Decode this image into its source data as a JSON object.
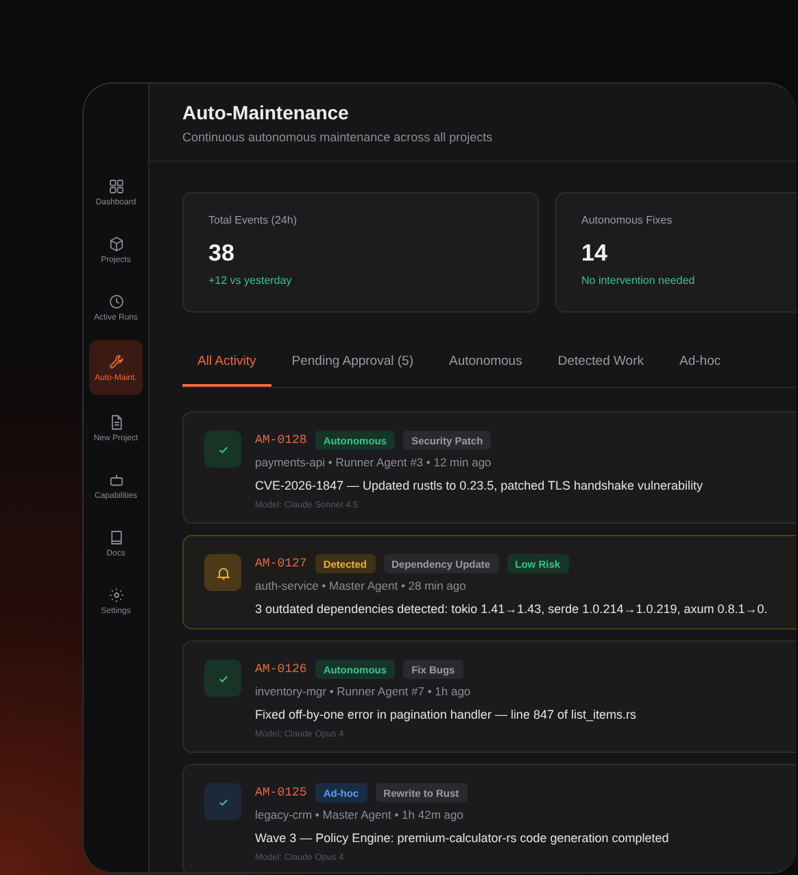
{
  "sidebar": {
    "items": [
      {
        "label": "Dashboard",
        "selected": false
      },
      {
        "label": "Projects",
        "selected": false
      },
      {
        "label": "Active Runs",
        "selected": false
      },
      {
        "label": "Auto-Maint.",
        "selected": true
      },
      {
        "label": "New Project",
        "selected": false
      },
      {
        "label": "Capabilities",
        "selected": false
      },
      {
        "label": "Docs",
        "selected": false
      },
      {
        "label": "Settings",
        "selected": false
      }
    ]
  },
  "header": {
    "title": "Auto-Maintenance",
    "subtitle": "Continuous autonomous maintenance across all projects"
  },
  "stats": [
    {
      "label": "Total Events (24h)",
      "value": "38",
      "note": "+12 vs yesterday"
    },
    {
      "label": "Autonomous Fixes",
      "value": "14",
      "note": "No intervention needed"
    }
  ],
  "tabs": [
    {
      "label": "All Activity",
      "selected": true
    },
    {
      "label": "Pending Approval (5)",
      "selected": false
    },
    {
      "label": "Autonomous",
      "selected": false
    },
    {
      "label": "Detected Work",
      "selected": false
    },
    {
      "label": "Ad-hoc",
      "selected": false
    }
  ],
  "events": [
    {
      "kind": "done",
      "id": "AM-0128",
      "badges": [
        {
          "label": "Autonomous",
          "kind": "mode"
        },
        {
          "label": "Security Patch",
          "kind": "category"
        }
      ],
      "meta": "payments-api • Runner Agent #3 • 12 min ago",
      "description": "CVE-2026-1847 — Updated rustls to 0.23.5, patched TLS handshake vulnerability",
      "model": "Model: Claude Sonnet 4.5"
    },
    {
      "kind": "alert",
      "id": "AM-0127",
      "badges": [
        {
          "label": "Detected",
          "kind": "pending"
        },
        {
          "label": "Dependency Update",
          "kind": "category"
        },
        {
          "label": "Low Risk",
          "kind": "risk"
        }
      ],
      "meta": "auth-service • Master Agent • 28 min ago",
      "description": "3 outdated dependencies detected: tokio 1.41→1.43, serde 1.0.214→1.0.219, axum 0.8.1→0."
    },
    {
      "kind": "done",
      "id": "AM-0126",
      "badges": [
        {
          "label": "Autonomous",
          "kind": "mode"
        },
        {
          "label": "Fix Bugs",
          "kind": "category"
        }
      ],
      "meta": "inventory-mgr • Runner Agent #7 • 1h ago",
      "description": "Fixed off-by-one error in pagination handler — line 847 of list_items.rs",
      "model": "Model: Claude Opus 4"
    },
    {
      "kind": "manual",
      "id": "AM-0125",
      "badges": [
        {
          "label": "Ad-hoc",
          "kind": "manual"
        },
        {
          "label": "Rewrite to Rust",
          "kind": "category"
        }
      ],
      "meta": "legacy-crm • Master Agent • 1h 42m ago",
      "description": "Wave 3 — Policy Engine: premium-calculator-rs code generation completed",
      "model": "Model: Claude Opus 4"
    }
  ]
}
